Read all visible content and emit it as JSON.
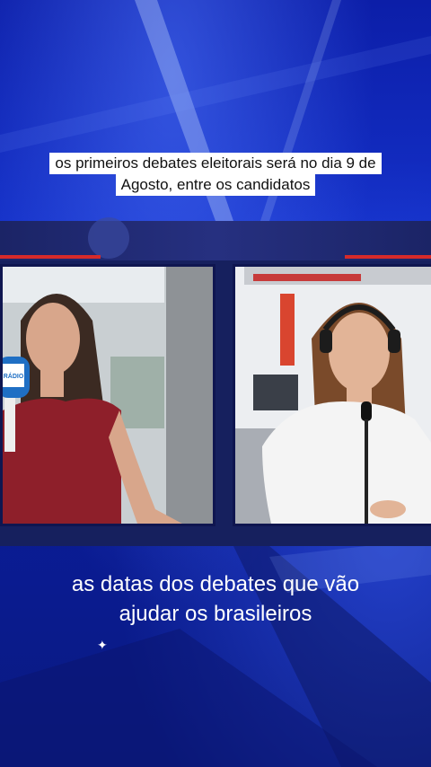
{
  "caption_top": {
    "line1": "os primeiros debates eleitorais será no dia 9 de",
    "line2": "Agosto, entre os candidatos"
  },
  "caption_bottom": {
    "line1": "as datas dos debates que vão",
    "line2": "ajudar os brasileiros"
  },
  "mic_badge_text": "RÁDIO",
  "colors": {
    "background": "#0c1ea8",
    "band": "#16205e",
    "accent_red": "#d62a2a"
  }
}
